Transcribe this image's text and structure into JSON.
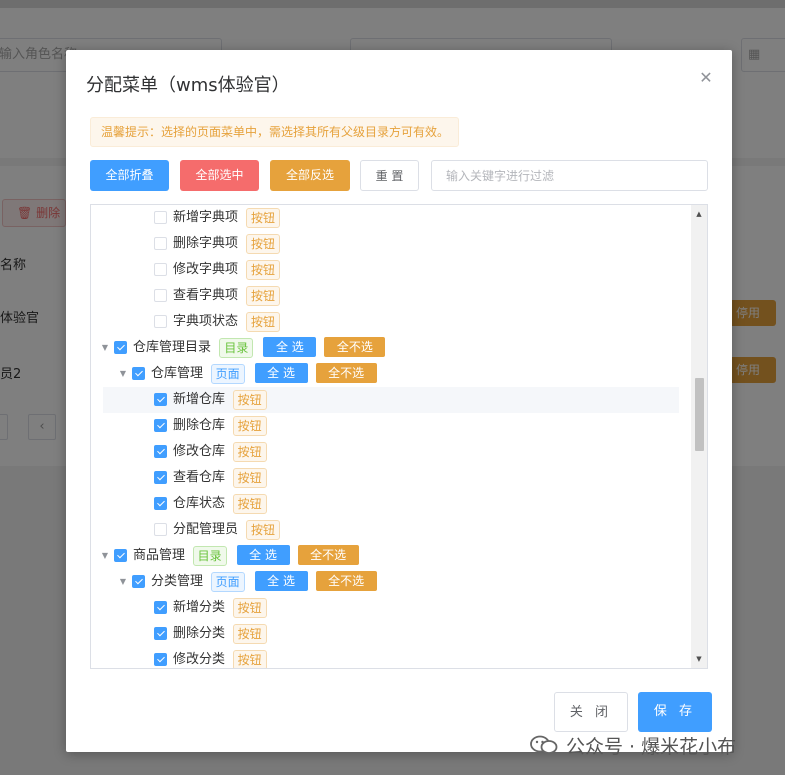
{
  "background": {
    "role_name_placeholder": "输入角色名称",
    "delete_label": "删除",
    "column_name": "名称",
    "row1_name": "体验官",
    "row2_name": "员2",
    "disable_label": "停用"
  },
  "dialog": {
    "title": "分配菜单（wms体验官）",
    "tip": "温馨提示：选择的页面菜单中，需选择其所有父级目录方可有效。",
    "buttons": {
      "collapse_all": "全部折叠",
      "select_all": "全部选中",
      "invert_all": "全部反选",
      "reset": "重 置"
    },
    "filter_placeholder": "输入关键字进行过滤",
    "tags": {
      "button": "按钮",
      "directory": "目录",
      "page": "页面"
    },
    "node_actions": {
      "select_all": "全 选",
      "deselect_all": "全不选"
    },
    "tree_nodes": [
      {
        "label": "新增字典项",
        "checked": false,
        "type": "button"
      },
      {
        "label": "删除字典项",
        "checked": false,
        "type": "button"
      },
      {
        "label": "修改字典项",
        "checked": false,
        "type": "button"
      },
      {
        "label": "查看字典项",
        "checked": false,
        "type": "button"
      },
      {
        "label": "字典项状态",
        "checked": false,
        "type": "button"
      },
      {
        "label": "仓库管理目录",
        "checked": true,
        "type": "directory",
        "expanded": true
      },
      {
        "label": "仓库管理",
        "checked": true,
        "type": "page",
        "expanded": true
      },
      {
        "label": "新增仓库",
        "checked": true,
        "type": "button",
        "highlighted": true
      },
      {
        "label": "删除仓库",
        "checked": true,
        "type": "button"
      },
      {
        "label": "修改仓库",
        "checked": true,
        "type": "button"
      },
      {
        "label": "查看仓库",
        "checked": true,
        "type": "button"
      },
      {
        "label": "仓库状态",
        "checked": true,
        "type": "button"
      },
      {
        "label": "分配管理员",
        "checked": false,
        "type": "button"
      },
      {
        "label": "商品管理",
        "checked": true,
        "type": "directory",
        "expanded": true
      },
      {
        "label": "分类管理",
        "checked": true,
        "type": "page",
        "expanded": true
      },
      {
        "label": "新增分类",
        "checked": true,
        "type": "button"
      },
      {
        "label": "删除分类",
        "checked": true,
        "type": "button"
      },
      {
        "label": "修改分类",
        "checked": true,
        "type": "button"
      }
    ],
    "footer": {
      "close": "关 闭",
      "save": "保 存"
    }
  },
  "watermark": "公众号 · 爆米花小布",
  "colors": {
    "primary": "#409eff",
    "danger": "#f56c6c",
    "warning": "#e6a23c",
    "success": "#67c23a"
  }
}
